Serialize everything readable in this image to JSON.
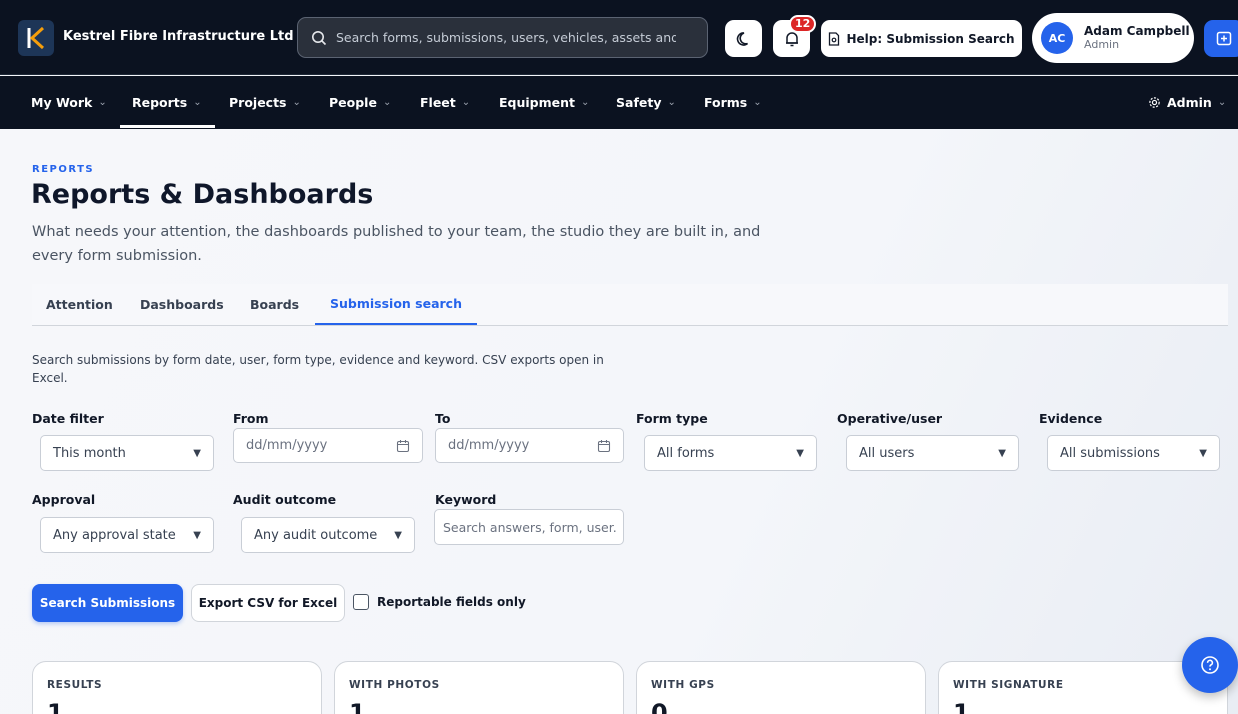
{
  "app": {
    "company_name": "Kestrel Fibre Infrastructure Ltd",
    "logo_letter": "K",
    "accent_color": "#2563eb"
  },
  "search": {
    "placeholder": "Search forms, submissions, users, vehicles, assets and"
  },
  "notifications": {
    "count": "12"
  },
  "help_button": {
    "label": "Help: Submission Search"
  },
  "user": {
    "initials": "AC",
    "name": "Adam Campbell",
    "role": "Admin"
  },
  "nav": {
    "items": [
      {
        "label": "My Work"
      },
      {
        "label": "Reports"
      },
      {
        "label": "Projects"
      },
      {
        "label": "People"
      },
      {
        "label": "Fleet"
      },
      {
        "label": "Equipment"
      },
      {
        "label": "Safety"
      },
      {
        "label": "Forms"
      }
    ],
    "active": "Reports",
    "admin_label": "Admin"
  },
  "page": {
    "eyebrow": "REPORTS",
    "title": "Reports & Dashboards",
    "description": "What needs your attention, the dashboards published to your team, the studio they are built in, and every form submission."
  },
  "tabs": [
    {
      "label": "Attention"
    },
    {
      "label": "Dashboards"
    },
    {
      "label": "Boards"
    },
    {
      "label": "Submission search"
    }
  ],
  "active_tab": "Submission search",
  "filters": {
    "hint": "Search submissions by form date, user, form type, evidence and keyword. CSV exports open in Excel.",
    "date_filter": {
      "label": "Date filter",
      "value": "This month"
    },
    "from": {
      "label": "From",
      "placeholder": "dd/mm/yyyy"
    },
    "to": {
      "label": "To",
      "placeholder": "dd/mm/yyyy"
    },
    "form_type": {
      "label": "Form type",
      "value": "All forms"
    },
    "operative": {
      "label": "Operative/user",
      "value": "All users"
    },
    "evidence": {
      "label": "Evidence",
      "value": "All submissions"
    },
    "approval": {
      "label": "Approval",
      "value": "Any approval state"
    },
    "audit": {
      "label": "Audit outcome",
      "value": "Any audit outcome"
    },
    "keyword": {
      "label": "Keyword",
      "placeholder": "Search answers, form, user."
    }
  },
  "actions": {
    "search": "Search Submissions",
    "export": "Export CSV for Excel",
    "reportable_only": "Reportable fields only"
  },
  "stats": [
    {
      "label": "RESULTS",
      "value": "1"
    },
    {
      "label": "WITH PHOTOS",
      "value": "1"
    },
    {
      "label": "WITH GPS",
      "value": "0"
    },
    {
      "label": "WITH SIGNATURE",
      "value": "1"
    }
  ]
}
